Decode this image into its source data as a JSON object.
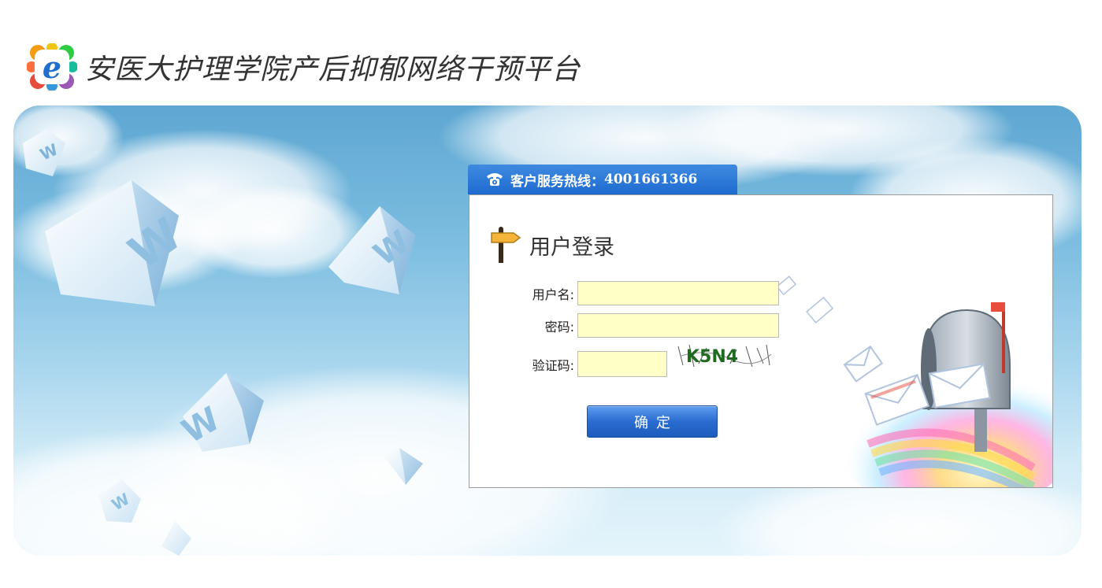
{
  "header": {
    "logo_icon": "ie-e-logo-icon",
    "title": "安医大护理学院产后抑郁网络干预平台"
  },
  "hotline": {
    "icon": "telephone-icon",
    "label": "客户服务热线：",
    "number": "4001661366",
    "color": "#2a72d6"
  },
  "login": {
    "icon": "signpost-icon",
    "title": "用户登录",
    "fields": {
      "username_label": "用户名:",
      "username_value": "",
      "password_label": "密码:",
      "password_value": "",
      "captcha_label": "验证码:",
      "captcha_value": ""
    },
    "captcha_text": "K5N4",
    "submit_label": "确定"
  },
  "colors": {
    "input_bg": "#ffffc6",
    "button_blue": "#2a6cd0",
    "sky_top": "#5ea7d2",
    "sky_bottom": "#e4f4fb"
  }
}
